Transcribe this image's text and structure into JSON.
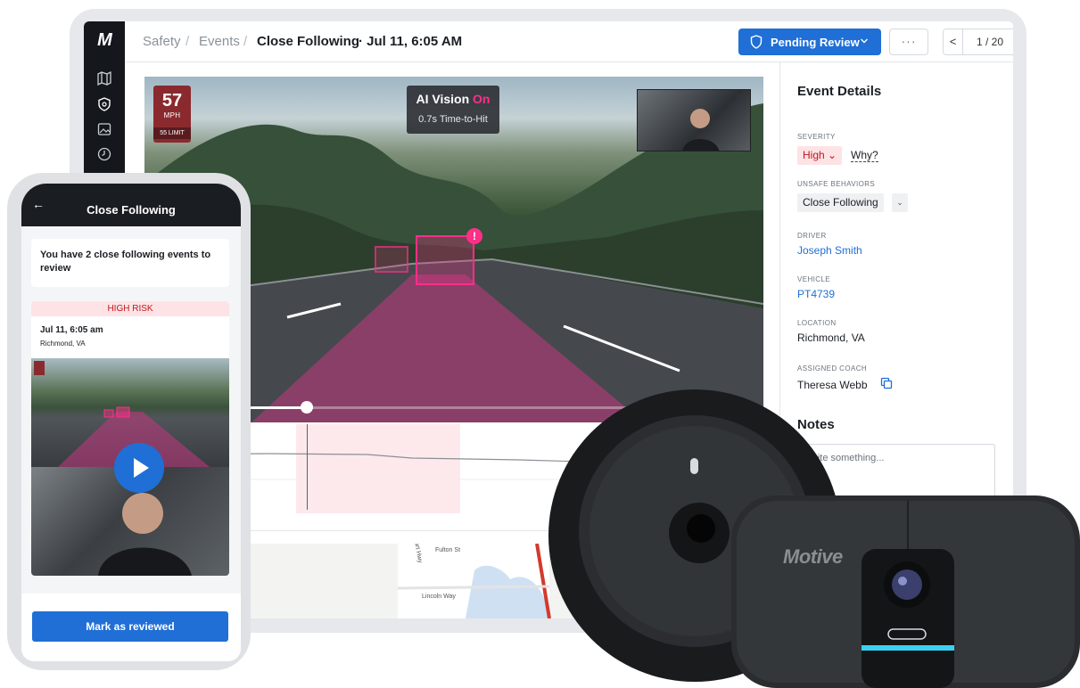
{
  "header": {
    "breadcrumbs": [
      "Safety",
      "Events"
    ],
    "title": "Close Following",
    "title_suffix": "· Jul 11, 6:05 AM",
    "status_label": "Pending Review",
    "more_label": "···",
    "pager_current": "1 / 20",
    "pager_prev": "<",
    "pager_next": ">"
  },
  "video": {
    "speed": "57",
    "speed_unit": "MPH",
    "speed_limit": "55 LIMIT",
    "ai_vision_label": "AI Vision",
    "ai_vision_state": "On",
    "time_to_hit": "0.7s Time-to-Hit",
    "alert_glyph": "!"
  },
  "details": {
    "title": "Event Details",
    "severity_label": "SEVERITY",
    "severity_value": "High",
    "severity_why": "Why?",
    "behaviors_label": "UNSAFE BEHAVIORS",
    "behavior_value": "Close Following",
    "driver_label": "DRIVER",
    "driver_value": "Joseph Smith",
    "vehicle_label": "VEHICLE",
    "vehicle_value": "PT4739",
    "location_label": "LOCATION",
    "location_value": "Richmond, VA",
    "coach_label": "ASSIGNED COACH",
    "coach_value": "Theresa Webb",
    "notes_title": "Notes",
    "notes_placeholder": "Write something..."
  },
  "map": {
    "labels": [
      "Fulton St",
      "Lincoln Way",
      "Hart Hwy"
    ]
  },
  "phone": {
    "back_glyph": "←",
    "title": "Close Following",
    "summary": "You have 2 close following events to review",
    "risk_label": "HIGH RISK",
    "event_time": "Jul 11, 6:05 am",
    "event_location": "Richmond, VA",
    "review_button": "Mark as reviewed"
  },
  "hardware": {
    "brand": "Motive"
  },
  "colors": {
    "accent": "#1f6fd6",
    "alert_pink": "#ff2e88",
    "severity_red": "#c4161c",
    "sidebar_dark": "#14181d"
  },
  "icons": {
    "sidebar": [
      "map-icon",
      "shield-icon",
      "image-icon",
      "clock-icon"
    ],
    "status": "shield-icon",
    "coach": "copy-icon",
    "play": "play-icon"
  }
}
